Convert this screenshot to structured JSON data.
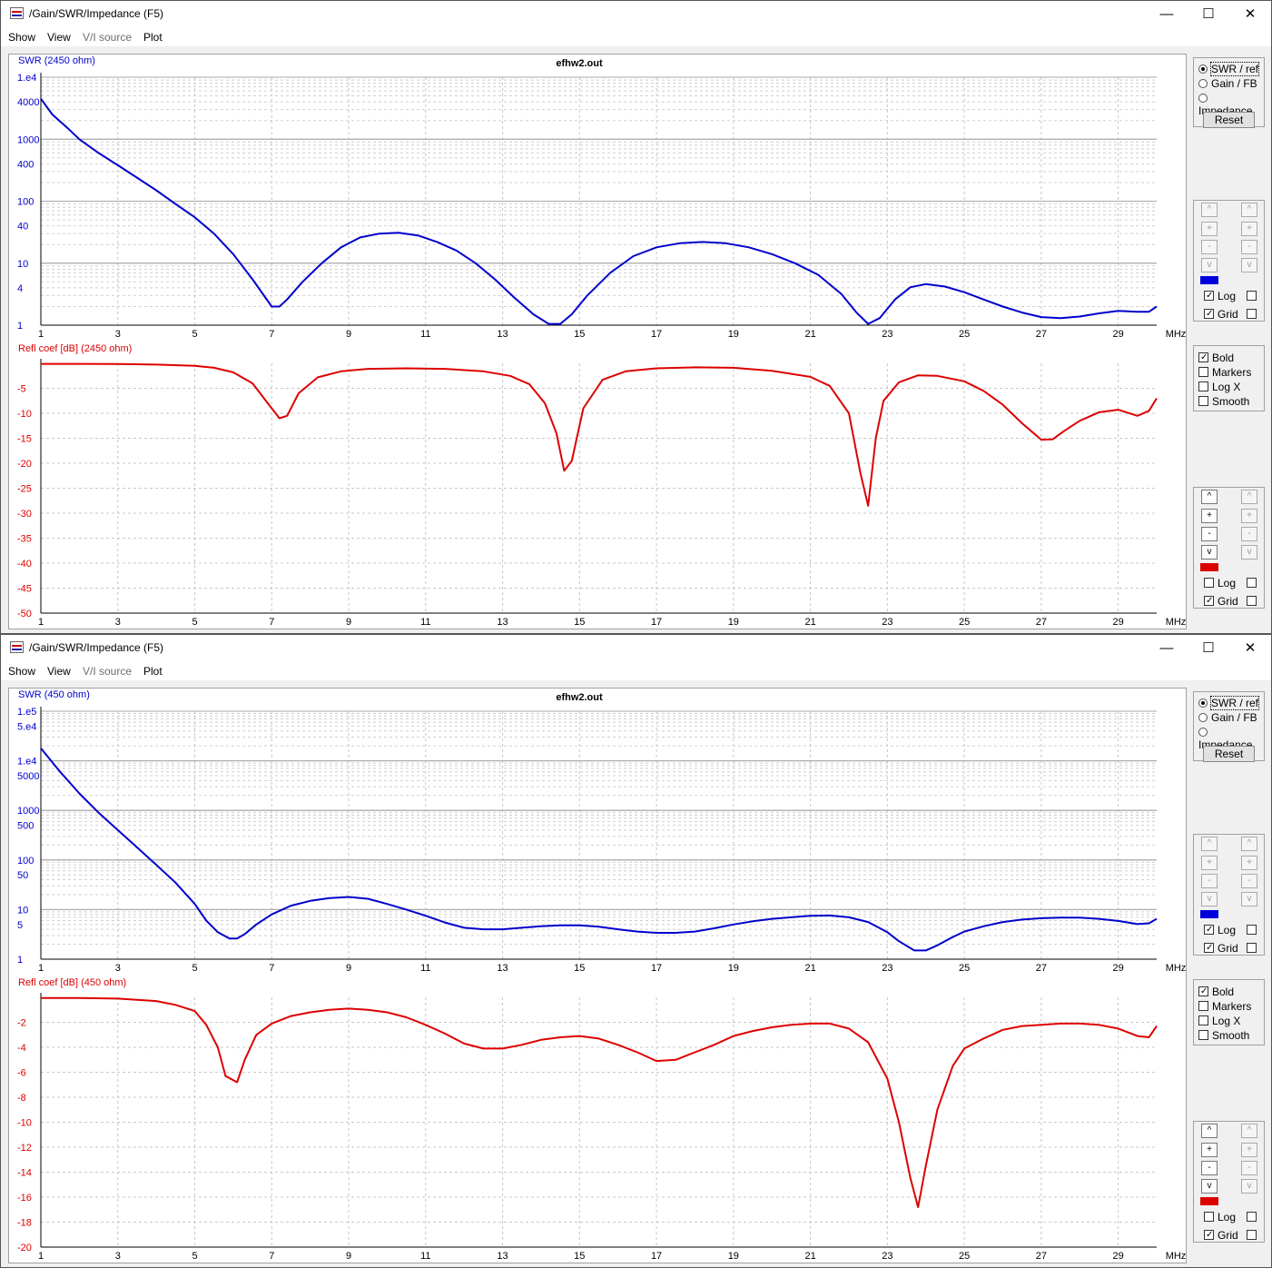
{
  "windows": [
    {
      "title": "/Gain/SWR/Impedance (F5)",
      "menu": [
        "Show",
        "View",
        "V/I source",
        "Plot"
      ],
      "file_label": "efhw2.out",
      "x_unit": "MHz",
      "x_ticks": [
        "1",
        "3",
        "5",
        "7",
        "9",
        "11",
        "13",
        "15",
        "17",
        "19",
        "21",
        "23",
        "25",
        "27",
        "29"
      ],
      "mode_options": [
        "SWR / ref",
        "Gain / FB",
        "Impedance"
      ],
      "mode_selected": 0,
      "reset_label": "Reset",
      "options": {
        "bold": true,
        "markers": false,
        "logx": false,
        "smooth": false
      },
      "option_labels": [
        "Bold",
        "Markers",
        "Log X",
        "Smooth"
      ],
      "top_controls": {
        "color": "#0000dd",
        "log": true,
        "grid": true
      },
      "bottom_controls": {
        "color": "#dd0000",
        "log": false,
        "grid": true
      },
      "control_labels": {
        "log": "Log",
        "grid": "Grid"
      },
      "button_glyphs": [
        "^",
        "+",
        "-",
        "v"
      ],
      "chart_data": [
        {
          "type": "line",
          "title": "SWR (2450 ohm)",
          "xlabel": "MHz",
          "scale": "log",
          "y_tick_labels": [
            "1.e4",
            "4000",
            "1000",
            "400",
            "100",
            "40",
            "10",
            "4",
            "1"
          ],
          "y_tick_values": [
            10000,
            4000,
            1000,
            400,
            100,
            40,
            10,
            4,
            1
          ],
          "ylim": [
            1,
            10000
          ],
          "xlim": [
            1,
            30
          ],
          "color": "#0000cc",
          "series": [
            {
              "x": [
                1,
                1.3,
                1.7,
                2,
                2.5,
                3,
                3.5,
                4,
                4.5,
                5,
                5.5,
                6,
                6.5,
                7,
                7.2,
                7.4,
                7.8,
                8.3,
                8.8,
                9.3,
                9.8,
                10.3,
                10.8,
                11.3,
                11.8,
                12.3,
                12.8,
                13.3,
                13.8,
                14.2,
                14.5,
                14.8,
                15.2,
                15.8,
                16.4,
                17,
                17.6,
                18.2,
                18.8,
                19.4,
                20,
                20.6,
                21.2,
                21.8,
                22.2,
                22.5,
                22.8,
                23.2,
                23.6,
                24,
                24.5,
                25,
                25.5,
                26,
                26.5,
                27,
                27.5,
                28,
                28.5,
                29,
                29.5,
                29.8,
                30
              ],
              "y": [
                4500,
                2500,
                1500,
                1000,
                600,
                380,
                240,
                150,
                90,
                55,
                30,
                14,
                5.5,
                2,
                2,
                2.6,
                5,
                10,
                18,
                26,
                30,
                31,
                28,
                22,
                16,
                10,
                5.5,
                2.8,
                1.5,
                1.05,
                1.05,
                1.5,
                3,
                7,
                13,
                18,
                21,
                22,
                21,
                18,
                14,
                10,
                6.5,
                3.2,
                1.6,
                1.05,
                1.3,
                2.6,
                4.1,
                4.6,
                4.2,
                3.4,
                2.6,
                2.0,
                1.6,
                1.35,
                1.3,
                1.38,
                1.55,
                1.7,
                1.65,
                1.65,
                2.0
              ]
            }
          ]
        },
        {
          "type": "line",
          "title": "Refl coef [dB] (2450 ohm)",
          "xlabel": "MHz",
          "scale": "linear",
          "y_tick_labels": [
            "-5",
            "-10",
            "-15",
            "-20",
            "-25",
            "-30",
            "-35",
            "-40",
            "-45",
            "-50"
          ],
          "y_tick_values": [
            -5,
            -10,
            -15,
            -20,
            -25,
            -30,
            -35,
            -40,
            -45,
            -50
          ],
          "ylim": [
            -50,
            0
          ],
          "xlim": [
            1,
            30
          ],
          "color": "#dd0000",
          "series": [
            {
              "x": [
                1,
                2,
                3,
                4,
                5,
                5.5,
                6,
                6.5,
                6.9,
                7.2,
                7.4,
                7.7,
                8.2,
                8.8,
                9.5,
                10.5,
                11.5,
                12.5,
                13.2,
                13.7,
                14.1,
                14.4,
                14.6,
                14.8,
                15.1,
                15.6,
                16.2,
                17,
                18,
                19,
                20,
                21,
                21.5,
                22,
                22.3,
                22.5,
                22.7,
                22.9,
                23.3,
                23.8,
                24.3,
                25,
                25.5,
                26,
                26.5,
                27,
                27.3,
                27.6,
                28,
                28.5,
                29,
                29.5,
                29.8,
                30
              ],
              "y": [
                -0.1,
                -0.1,
                -0.15,
                -0.25,
                -0.5,
                -0.9,
                -1.8,
                -4,
                -8,
                -11,
                -10.5,
                -6,
                -2.8,
                -1.6,
                -1.1,
                -1,
                -1.1,
                -1.6,
                -2.5,
                -4.2,
                -8,
                -14,
                -21.5,
                -19.5,
                -9,
                -3.3,
                -1.6,
                -1,
                -0.8,
                -0.9,
                -1.5,
                -2.7,
                -4.5,
                -10,
                -22,
                -28.5,
                -15,
                -7.5,
                -3.8,
                -2.4,
                -2.5,
                -3.6,
                -5.5,
                -8.3,
                -12,
                -15.3,
                -15.2,
                -13.5,
                -11.5,
                -9.8,
                -9.3,
                -10.5,
                -9.5,
                -7
              ]
            }
          ]
        }
      ]
    },
    {
      "title": "/Gain/SWR/Impedance (F5)",
      "menu": [
        "Show",
        "View",
        "V/I source",
        "Plot"
      ],
      "file_label": "efhw2.out",
      "x_unit": "MHz",
      "x_ticks": [
        "1",
        "3",
        "5",
        "7",
        "9",
        "11",
        "13",
        "15",
        "17",
        "19",
        "21",
        "23",
        "25",
        "27",
        "29"
      ],
      "mode_options": [
        "SWR / ref",
        "Gain / FB",
        "Impedance"
      ],
      "mode_selected": 0,
      "reset_label": "Reset",
      "options": {
        "bold": true,
        "markers": false,
        "logx": false,
        "smooth": false
      },
      "option_labels": [
        "Bold",
        "Markers",
        "Log X",
        "Smooth"
      ],
      "top_controls": {
        "color": "#0000dd",
        "log": true,
        "grid": true
      },
      "bottom_controls": {
        "color": "#dd0000",
        "log": false,
        "grid": true
      },
      "control_labels": {
        "log": "Log",
        "grid": "Grid"
      },
      "button_glyphs": [
        "^",
        "+",
        "-",
        "v"
      ],
      "chart_data": [
        {
          "type": "line",
          "title": "SWR (450 ohm)",
          "xlabel": "MHz",
          "scale": "log",
          "y_tick_labels": [
            "1.e5",
            "5.e4",
            "1.e4",
            "5000",
            "1000",
            "500",
            "100",
            "50",
            "10",
            "5",
            "1"
          ],
          "y_tick_values": [
            100000,
            50000,
            10000,
            5000,
            1000,
            500,
            100,
            50,
            10,
            5,
            1
          ],
          "ylim": [
            1,
            100000
          ],
          "xlim": [
            1,
            30
          ],
          "color": "#0000cc",
          "series": [
            {
              "x": [
                1,
                1.5,
                2,
                2.5,
                3,
                3.5,
                4,
                4.5,
                5,
                5.3,
                5.6,
                5.9,
                6.1,
                6.3,
                6.6,
                7,
                7.5,
                8,
                8.5,
                9,
                9.5,
                10,
                10.5,
                11,
                11.5,
                12,
                12.5,
                13,
                13.5,
                14,
                14.5,
                15,
                15.5,
                16,
                16.5,
                17,
                17.5,
                18,
                18.5,
                19,
                19.5,
                20,
                20.5,
                21,
                21.5,
                22,
                22.5,
                23,
                23.3,
                23.7,
                24,
                24.3,
                24.7,
                25,
                25.5,
                26,
                26.5,
                27,
                27.5,
                28,
                28.5,
                29,
                29.5,
                29.8,
                30
              ],
              "y": [
                18000,
                6000,
                2200,
                900,
                400,
                180,
                80,
                35,
                13,
                6,
                3.5,
                2.6,
                2.6,
                3.2,
                5,
                8,
                12,
                15,
                17,
                18,
                16.5,
                13,
                10,
                7.5,
                5.5,
                4.3,
                4,
                4,
                4.3,
                4.6,
                4.8,
                4.8,
                4.5,
                4,
                3.6,
                3.4,
                3.4,
                3.6,
                4.2,
                5,
                5.8,
                6.5,
                7,
                7.5,
                7.6,
                7,
                5.6,
                3.5,
                2.3,
                1.5,
                1.5,
                1.9,
                2.8,
                3.6,
                4.6,
                5.6,
                6.3,
                6.7,
                6.9,
                6.9,
                6.5,
                5.9,
                5.1,
                5.3,
                6.5
              ]
            }
          ]
        },
        {
          "type": "line",
          "title": "Refl coef [dB] (450 ohm)",
          "xlabel": "MHz",
          "scale": "linear",
          "y_tick_labels": [
            "-2",
            "-4",
            "-6",
            "-8",
            "-10",
            "-12",
            "-14",
            "-16",
            "-18",
            "-20"
          ],
          "y_tick_values": [
            -2,
            -4,
            -6,
            -8,
            -10,
            -12,
            -14,
            -16,
            -18,
            -20
          ],
          "ylim": [
            -20,
            0
          ],
          "xlim": [
            1,
            30
          ],
          "color": "#dd0000",
          "series": [
            {
              "x": [
                1,
                2,
                3,
                4,
                4.5,
                5,
                5.3,
                5.6,
                5.8,
                6.1,
                6.3,
                6.6,
                7,
                7.5,
                8,
                8.5,
                9,
                9.5,
                10,
                10.5,
                11,
                11.5,
                12,
                12.5,
                13,
                13.5,
                14,
                14.5,
                15,
                15.5,
                16,
                16.5,
                17,
                17.5,
                18,
                18.5,
                19,
                19.5,
                20,
                20.5,
                21,
                21.5,
                22,
                22.5,
                23,
                23.3,
                23.6,
                23.8,
                24,
                24.3,
                24.7,
                25,
                25.5,
                26,
                26.5,
                27,
                27.5,
                28,
                28.5,
                29,
                29.5,
                29.8,
                30
              ],
              "y": [
                -0.05,
                -0.05,
                -0.1,
                -0.3,
                -0.6,
                -1.1,
                -2.2,
                -4,
                -6.3,
                -6.8,
                -5,
                -3,
                -2.1,
                -1.5,
                -1.2,
                -1,
                -0.9,
                -1,
                -1.2,
                -1.6,
                -2.2,
                -2.9,
                -3.7,
                -4.1,
                -4.1,
                -3.8,
                -3.4,
                -3.2,
                -3.1,
                -3.3,
                -3.8,
                -4.4,
                -5.1,
                -5,
                -4.4,
                -3.8,
                -3.1,
                -2.7,
                -2.4,
                -2.2,
                -2.1,
                -2.1,
                -2.5,
                -3.6,
                -6.5,
                -10,
                -14.5,
                -16.8,
                -13.5,
                -9,
                -5.5,
                -4.1,
                -3.3,
                -2.6,
                -2.3,
                -2.2,
                -2.1,
                -2.1,
                -2.2,
                -2.5,
                -3.1,
                -3.2,
                -2.3
              ]
            }
          ]
        }
      ]
    }
  ]
}
